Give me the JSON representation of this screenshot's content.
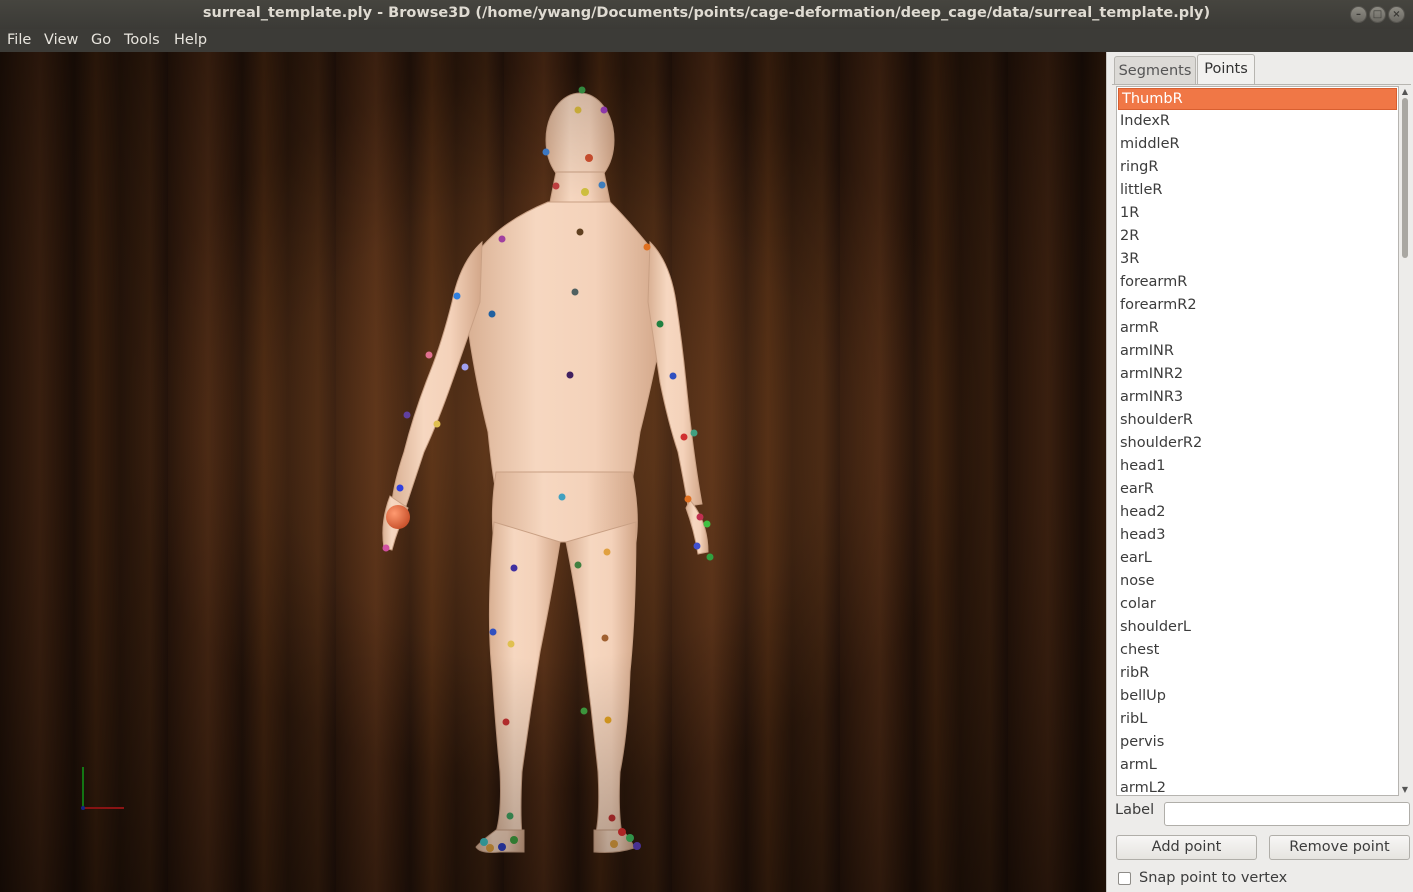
{
  "window": {
    "title": "surreal_template.ply - Browse3D (/home/ywang/Documents/points/cage-deformation/deep_cage/data/surreal_template.ply)",
    "controls": [
      "–",
      "□",
      "×"
    ]
  },
  "menu": [
    "File",
    "View",
    "Go",
    "Tools",
    "Help"
  ],
  "tabs": {
    "segments": "Segments",
    "points": "Points",
    "active": "Points"
  },
  "points": {
    "selected": "ThumbR",
    "items": [
      "ThumbR",
      "IndexR",
      "middleR",
      "ringR",
      "littleR",
      "1R",
      "2R",
      "3R",
      "forearmR",
      "forearmR2",
      "armR",
      "armINR",
      "armINR2",
      "armINR3",
      "shoulderR",
      "shoulderR2",
      "head1",
      "earR",
      "head2",
      "head3",
      "earL",
      "nose",
      "colar",
      "shoulderL",
      "chest",
      "ribR",
      "bellUp",
      "ribL",
      "pervis",
      "armL",
      "armL2"
    ]
  },
  "label_field": {
    "label": "Label",
    "value": ""
  },
  "buttons": {
    "add": "Add point",
    "remove": "Remove point"
  },
  "snap": {
    "label": "Snap point to vertex",
    "checked": false
  },
  "colors": {
    "selection": "#f07746",
    "skin": "#f3cfb3",
    "axis_x": "#e02020",
    "axis_y": "#20c020"
  },
  "icons": [
    "minimize-icon",
    "maximize-icon",
    "close-icon",
    "axis-gizmo-icon"
  ]
}
